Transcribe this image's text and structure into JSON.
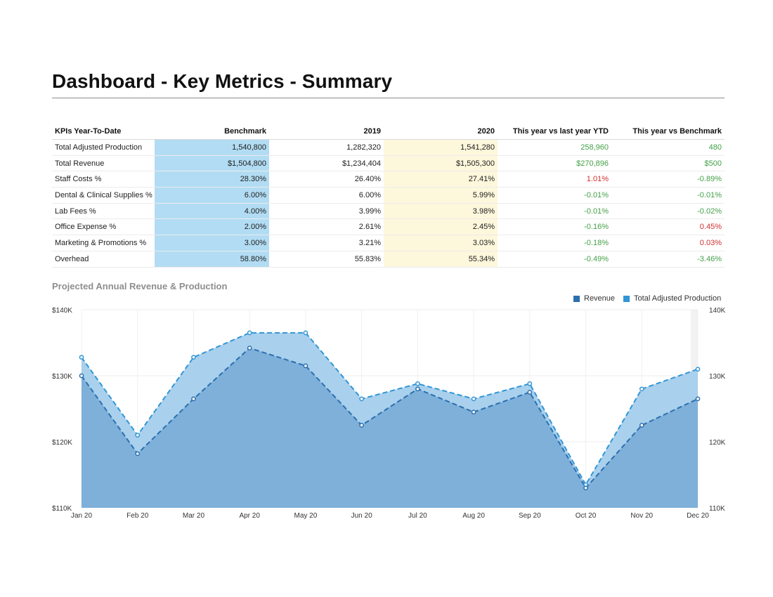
{
  "header": {
    "title": "Dashboard - Key Metrics - Summary"
  },
  "kpi_table": {
    "columns": [
      "KPIs Year-To-Date",
      "Benchmark",
      "2019",
      "2020",
      "This year vs last year YTD",
      "This year vs Benchmark"
    ],
    "rows": [
      {
        "kpi": "Total Adjusted Production",
        "benchmark": "1,540,800",
        "y2019": "1,282,320",
        "y2020": "1,541,280",
        "vs_last_year": "258,960",
        "vs_last_year_status": "pos",
        "vs_benchmark": "480",
        "vs_benchmark_status": "pos"
      },
      {
        "kpi": "Total Revenue",
        "benchmark": "$1,504,800",
        "y2019": "$1,234,404",
        "y2020": "$1,505,300",
        "vs_last_year": "$270,896",
        "vs_last_year_status": "pos",
        "vs_benchmark": "$500",
        "vs_benchmark_status": "pos"
      },
      {
        "kpi": "Staff Costs %",
        "benchmark": "28.30%",
        "y2019": "26.40%",
        "y2020": "27.41%",
        "vs_last_year": "1.01%",
        "vs_last_year_status": "neg",
        "vs_benchmark": "-0.89%",
        "vs_benchmark_status": "pos"
      },
      {
        "kpi": "Dental & Clinical Supplies %",
        "benchmark": "6.00%",
        "y2019": "6.00%",
        "y2020": "5.99%",
        "vs_last_year": "-0.01%",
        "vs_last_year_status": "pos",
        "vs_benchmark": "-0.01%",
        "vs_benchmark_status": "pos"
      },
      {
        "kpi": "Lab Fees %",
        "benchmark": "4.00%",
        "y2019": "3.99%",
        "y2020": "3.98%",
        "vs_last_year": "-0.01%",
        "vs_last_year_status": "pos",
        "vs_benchmark": "-0.02%",
        "vs_benchmark_status": "pos"
      },
      {
        "kpi": "Office Expense %",
        "benchmark": "2.00%",
        "y2019": "2.61%",
        "y2020": "2.45%",
        "vs_last_year": "-0.16%",
        "vs_last_year_status": "pos",
        "vs_benchmark": "0.45%",
        "vs_benchmark_status": "neg"
      },
      {
        "kpi": "Marketing & Promotions %",
        "benchmark": "3.00%",
        "y2019": "3.21%",
        "y2020": "3.03%",
        "vs_last_year": "-0.18%",
        "vs_last_year_status": "pos",
        "vs_benchmark": "0.03%",
        "vs_benchmark_status": "neg"
      },
      {
        "kpi": "Overhead",
        "benchmark": "58.80%",
        "y2019": "55.83%",
        "y2020": "55.34%",
        "vs_last_year": "-0.49%",
        "vs_last_year_status": "pos",
        "vs_benchmark": "-3.46%",
        "vs_benchmark_status": "pos"
      }
    ]
  },
  "colors": {
    "benchmark_highlight": "#b2dcf3",
    "year_2020_highlight": "#fdf7dc",
    "positive": "#43a047",
    "negative": "#d32f2f",
    "revenue": "#2d6fae",
    "production": "#3196d6"
  },
  "chart_data": {
    "type": "area",
    "title": "Projected Annual Revenue & Production",
    "categories": [
      "Jan 20",
      "Feb 20",
      "Mar 20",
      "Apr 20",
      "May 20",
      "Jun 20",
      "Jul 20",
      "Aug 20",
      "Sep 20",
      "Oct 20",
      "Nov 20",
      "Dec 20"
    ],
    "series": [
      {
        "name": "Revenue",
        "values": [
          130000,
          118200,
          126500,
          134200,
          131500,
          122500,
          128000,
          124500,
          127500,
          113000,
          122500,
          126500
        ]
      },
      {
        "name": "Total Adjusted Production",
        "values": [
          132800,
          121000,
          132800,
          136500,
          136500,
          126500,
          128800,
          126500,
          128800,
          113500,
          128000,
          131000
        ]
      }
    ],
    "y_left": {
      "min": 110000,
      "max": 140000,
      "ticks": [
        "$110K",
        "$120K",
        "$130K",
        "$140K"
      ]
    },
    "y_right": {
      "min": 110000,
      "max": 140000,
      "ticks": [
        "110K",
        "120K",
        "130K",
        "140K"
      ]
    },
    "legend_position": "top-right",
    "grid": true
  }
}
